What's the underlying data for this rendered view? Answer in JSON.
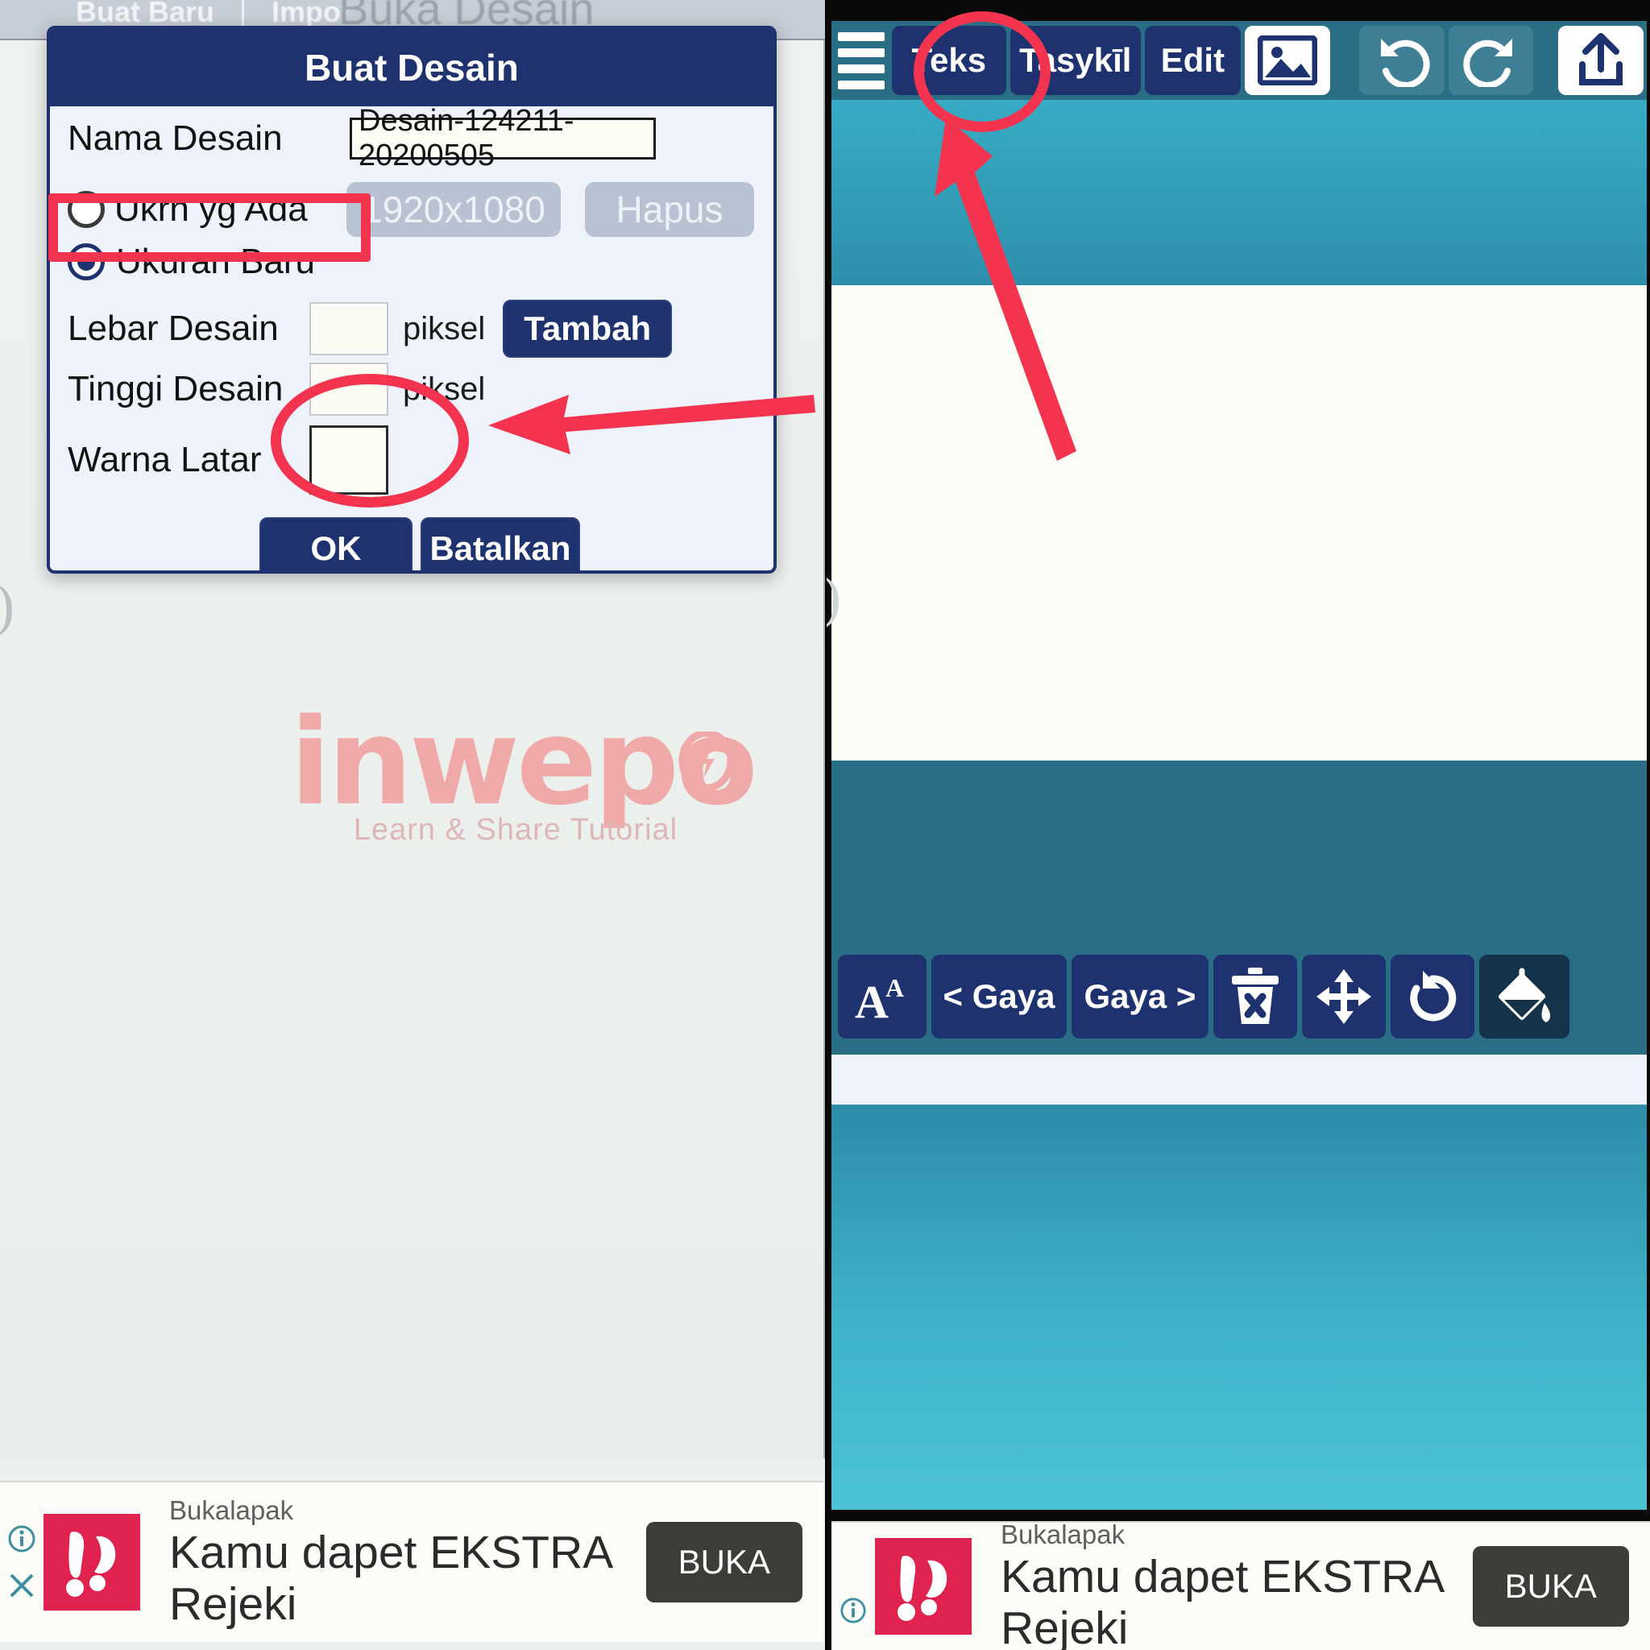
{
  "left": {
    "topbar": {
      "tabs": [
        "Buat Baru",
        "Impor"
      ],
      "ghost_title": "Buka Desain"
    },
    "dialog": {
      "title": "Buat Desain",
      "fields": {
        "nama_label": "Nama Desain",
        "nama_value": "Desain-124211-20200505",
        "ukrn_ada_label": "Ukrn yg Ada",
        "ukrn_ada_value": "1920x1080",
        "hapus_label": "Hapus",
        "ukuran_baru_label": "Ukuran Baru",
        "lebar_label": "Lebar Desain",
        "lebar_value": "",
        "lebar_unit": "piksel",
        "tambah_label": "Tambah",
        "tinggi_label": "Tinggi Desain",
        "tinggi_value": "",
        "tinggi_unit": "piksel",
        "warna_latar_label": "Warna Latar",
        "warna_latar_value": "#FFFFFF"
      },
      "ok_label": "OK",
      "cancel_label": "Batalkan"
    },
    "watermark": {
      "main": "inwepo",
      "sub": "Learn & Share Tutorial"
    },
    "ad": {
      "brand": "Bukalapak",
      "title_line1": "Kamu dapet EKSTRA",
      "title_line2": "Rejeki",
      "cta": "BUKA"
    }
  },
  "right": {
    "toolbar": {
      "menu_icon": "hamburger-icon",
      "buttons": [
        "Teks",
        "Tasykīl",
        "Edit"
      ],
      "image_icon": "image-icon",
      "undo_icon": "undo-icon",
      "redo_icon": "redo-icon",
      "share_icon": "share-icon"
    },
    "edit_toolbar": {
      "font_size_icon": "font-size-icon",
      "prev_style_label": "< Gaya",
      "next_style_label": "Gaya >",
      "delete_icon": "trash-delete-icon",
      "move_icon": "move-arrows-icon",
      "rotate_icon": "rotate-icon",
      "fill_icon": "paint-bucket-icon"
    },
    "ad": {
      "brand": "Bukalapak",
      "title_line1": "Kamu dapet EKSTRA",
      "title_line2": "Rejeki",
      "cta": "BUKA"
    }
  },
  "annotations": {
    "accent_color": "#F4344F",
    "highlight_ukuran_baru": "rectangle",
    "highlight_warna_latar": "ellipse-with-arrow",
    "highlight_teks_button": "ellipse-with-arrow"
  }
}
